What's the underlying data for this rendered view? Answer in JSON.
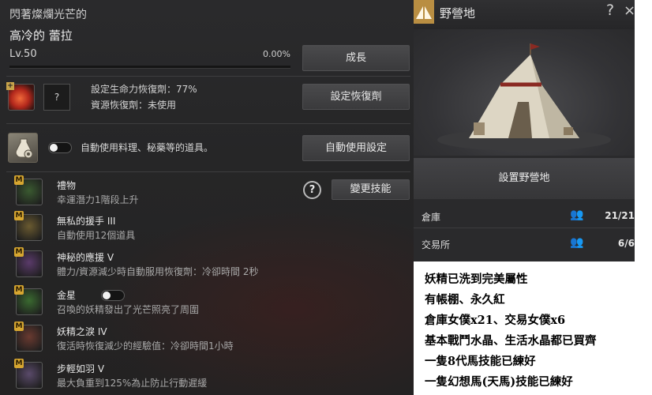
{
  "fairy": {
    "epithet": "閃著燦爛光芒的",
    "name": "高冷的 蕾拉",
    "level": "Lv.50",
    "exp_percent": "0.00%",
    "exp_fraction": 0,
    "grow_button": "成長",
    "potion": {
      "slot_label": "?",
      "hp_recovery": "設定生命力恢復劑：77%",
      "resource_recovery": "資源恢復劑：未使用",
      "button": "設定恢復劑"
    },
    "auto_use": {
      "toggle_on": false,
      "text": "自動使用料理、秘藥等的道具。",
      "button": "自動使用設定"
    },
    "help_label": "?",
    "change_skill_button": "變更技能",
    "skills": [
      {
        "badge": "M",
        "name": "禮物",
        "desc": "幸運潛力1階段上升",
        "color": "#3a5a30"
      },
      {
        "badge": "M",
        "name": "無私的援手 III",
        "desc": "自動使用12個道具",
        "color": "#6a5a30"
      },
      {
        "badge": "M",
        "name": "神秘的應援 V",
        "desc": "體力/資源減少時自動服用恢復劑：冷卻時間 2秒",
        "color": "#5a3a6a"
      },
      {
        "badge": "M",
        "name": "金星",
        "desc": "召喚的妖精發出了光芒照亮了周圍",
        "color": "#3a6a30",
        "has_toggle": true
      },
      {
        "badge": "M",
        "name": "妖精之淚 IV",
        "desc": "復活時恢復減少的經驗值：冷卻時間1小時",
        "color": "#6a3a30"
      },
      {
        "badge": "M",
        "name": "步輕如羽 V",
        "desc": "最大負重到125%為止防止行動遲緩",
        "color": "#5a4a6a"
      }
    ]
  },
  "camp": {
    "title": "野營地",
    "help": "?",
    "close": "×",
    "setup_button": "設置野營地",
    "rows": [
      {
        "label": "倉庫",
        "icon": "maid-icon",
        "value": "21/21"
      },
      {
        "label": "交易所",
        "icon": "maid-icon",
        "value": "6/6"
      }
    ]
  },
  "note": [
    "妖精已洗到完美屬性",
    "有帳棚、永久紅",
    "倉庫女僕x21、交易女僕x6",
    "基本戰鬥水晶、生活水晶都已買齊",
    "一隻8代馬技能已練好",
    "一隻幻想馬(天馬)技能已練好"
  ],
  "colors": {
    "accent_gold": "#c9a44a",
    "badge_gold": "#d6a630"
  }
}
